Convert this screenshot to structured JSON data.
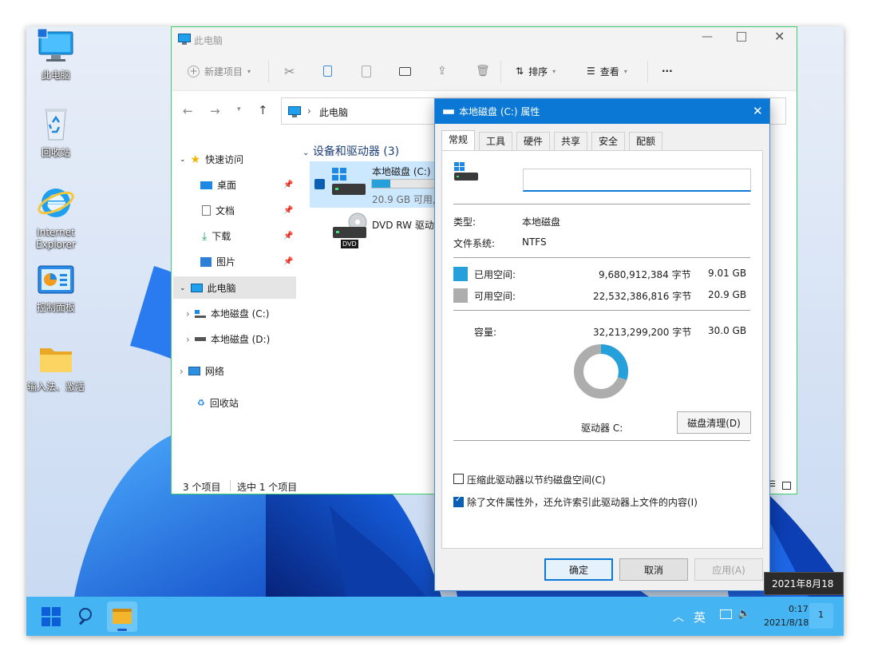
{
  "desktop": {
    "icons": [
      {
        "label": "此电脑",
        "icon": "computer-icon"
      },
      {
        "label": "回收站",
        "icon": "recycle-bin-icon"
      },
      {
        "label_line1": "Internet",
        "label_line2": "Explorer",
        "icon": "ie-icon"
      },
      {
        "label": "控制面板",
        "icon": "control-panel-icon"
      },
      {
        "label": "输入法、激活",
        "icon": "folder-icon"
      }
    ]
  },
  "explorer": {
    "title": "此电脑",
    "toolbar": {
      "new_item": "新建项目",
      "sort": "排序",
      "view": "查看",
      "more": "···"
    },
    "address": {
      "location": "此电脑"
    },
    "nav": {
      "quick_access": "快速访问",
      "desktop": "桌面",
      "documents": "文档",
      "downloads": "下载",
      "pictures": "图片",
      "this_pc": "此电脑",
      "drive_c": "本地磁盘 (C:)",
      "drive_d": "本地磁盘 (D:)",
      "network": "网络",
      "recycle_bin": "回收站"
    },
    "group_header": "设备和驱动器 (3)",
    "drives": [
      {
        "name": "本地磁盘 (C:)",
        "free": "20.9 GB 可用,",
        "used_fraction": 0.3
      },
      {
        "name": "DVD RW 驱动",
        "badge": "DVD"
      }
    ],
    "status": {
      "count": "3 个项目",
      "selected": "选中 1 个项目"
    }
  },
  "dialog": {
    "title": "本地磁盘 (C:) 属性",
    "tabs": [
      "常规",
      "工具",
      "硬件",
      "共享",
      "安全",
      "配额"
    ],
    "label_value": "",
    "type_label": "类型:",
    "type_value": "本地磁盘",
    "fs_label": "文件系统:",
    "fs_value": "NTFS",
    "used_label": "已用空间:",
    "used_bytes": "9,680,912,384 字节",
    "used_size": "9.01 GB",
    "free_label": "可用空间:",
    "free_bytes": "22,532,386,816 字节",
    "free_size": "20.9 GB",
    "capacity_label": "容量:",
    "capacity_bytes": "32,213,299,200 字节",
    "capacity_size": "30.0 GB",
    "drive_label": "驱动器 C:",
    "cleanup_button": "磁盘清理(D)",
    "compress_label": "压缩此驱动器以节约磁盘空间(C)",
    "compress_checked": false,
    "index_label": "除了文件属性外，还允许索引此驱动器上文件的内容(I)",
    "index_checked": true,
    "ok": "确定",
    "cancel": "取消",
    "apply": "应用(A)",
    "used_fraction": 0.3005,
    "colors": {
      "used": "#26a0da",
      "free": "#adadad",
      "titlebar": "#0a78d4"
    }
  },
  "taskbar": {
    "ime": "英",
    "time": "0:17",
    "date": "2021/8/18",
    "notifications": "1",
    "tooltip": "2021年8月18日"
  }
}
